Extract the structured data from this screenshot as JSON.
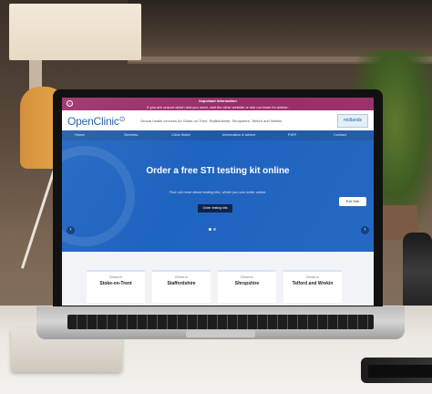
{
  "alert": {
    "title": "Important Information",
    "message": "If you are unsure which test you need, visit the clinic website or ask our team for advice."
  },
  "header": {
    "logo": "OpenClinic",
    "tagline": "Sexual health services for Stoke-on-Trent, Staffordshire, Shropshire, Telford and Wrekin",
    "partner": "midlands"
  },
  "nav": {
    "items": [
      "Home",
      "Services",
      "Clinic finder",
      "Information & advice",
      "PrEP",
      "Contact"
    ]
  },
  "hero": {
    "title": "Order a free STI testing kit online",
    "subtitle": "Find out more about testing kits, which you can order online.",
    "cta": "Order testing kits",
    "side_button": "Exit Site"
  },
  "cards": [
    {
      "top": "Clinics in",
      "title": "Stoke-on-Trent"
    },
    {
      "top": "Clinics in",
      "title": "Staffordshire"
    },
    {
      "top": "Clinics in",
      "title": "Shropshire"
    },
    {
      "top": "Clinics in",
      "title": "Telford and Wrekin"
    }
  ],
  "colors": {
    "primary": "#1f5aa6",
    "hero": "#1e63c0",
    "alert": "#9a2d6a"
  }
}
